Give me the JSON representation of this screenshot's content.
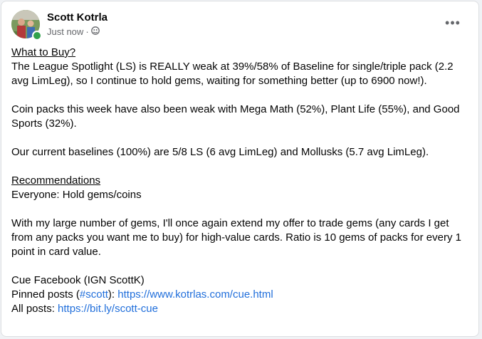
{
  "post": {
    "author": "Scott Kotrla",
    "timestamp": "Just now",
    "separator": "·",
    "privacy_icon": "friends-globe-icon",
    "more_label": "•••",
    "heading1": "What to Buy?",
    "para1": "The League Spotlight (LS) is REALLY weak at 39%/58% of Baseline for single/triple pack (2.2 avg LimLeg), so I continue to hold gems, waiting for something better (up to 6900 now!).",
    "para2": "Coin packs this week have also been weak with Mega Math (52%), Plant Life (55%), and Good Sports (32%).",
    "para3": "Our current baselines (100%) are 5/8 LS (6 avg LimLeg) and Mollusks (5.7 avg LimLeg).",
    "heading2": "Recommendations",
    "reco_line": "Everyone: Hold gems/coins",
    "para4": "With my large number of gems, I'll once again extend my offer to trade gems (any cards I get from any packs you want me to buy) for high-value cards. Ratio is 10 gems of packs for every 1 point in card value.",
    "cue_line": "Cue Facebook (IGN ScottK)",
    "pinned_prefix": "Pinned posts (",
    "pinned_hashtag": "#scott",
    "pinned_mid": "): ",
    "pinned_url": "https://www.kotrlas.com/cue.html",
    "all_prefix": "All posts: ",
    "all_url": "https://bit.ly/scott-cue"
  },
  "colors": {
    "link": "#216fdb",
    "online": "#31a24c",
    "meta": "#65676b"
  }
}
